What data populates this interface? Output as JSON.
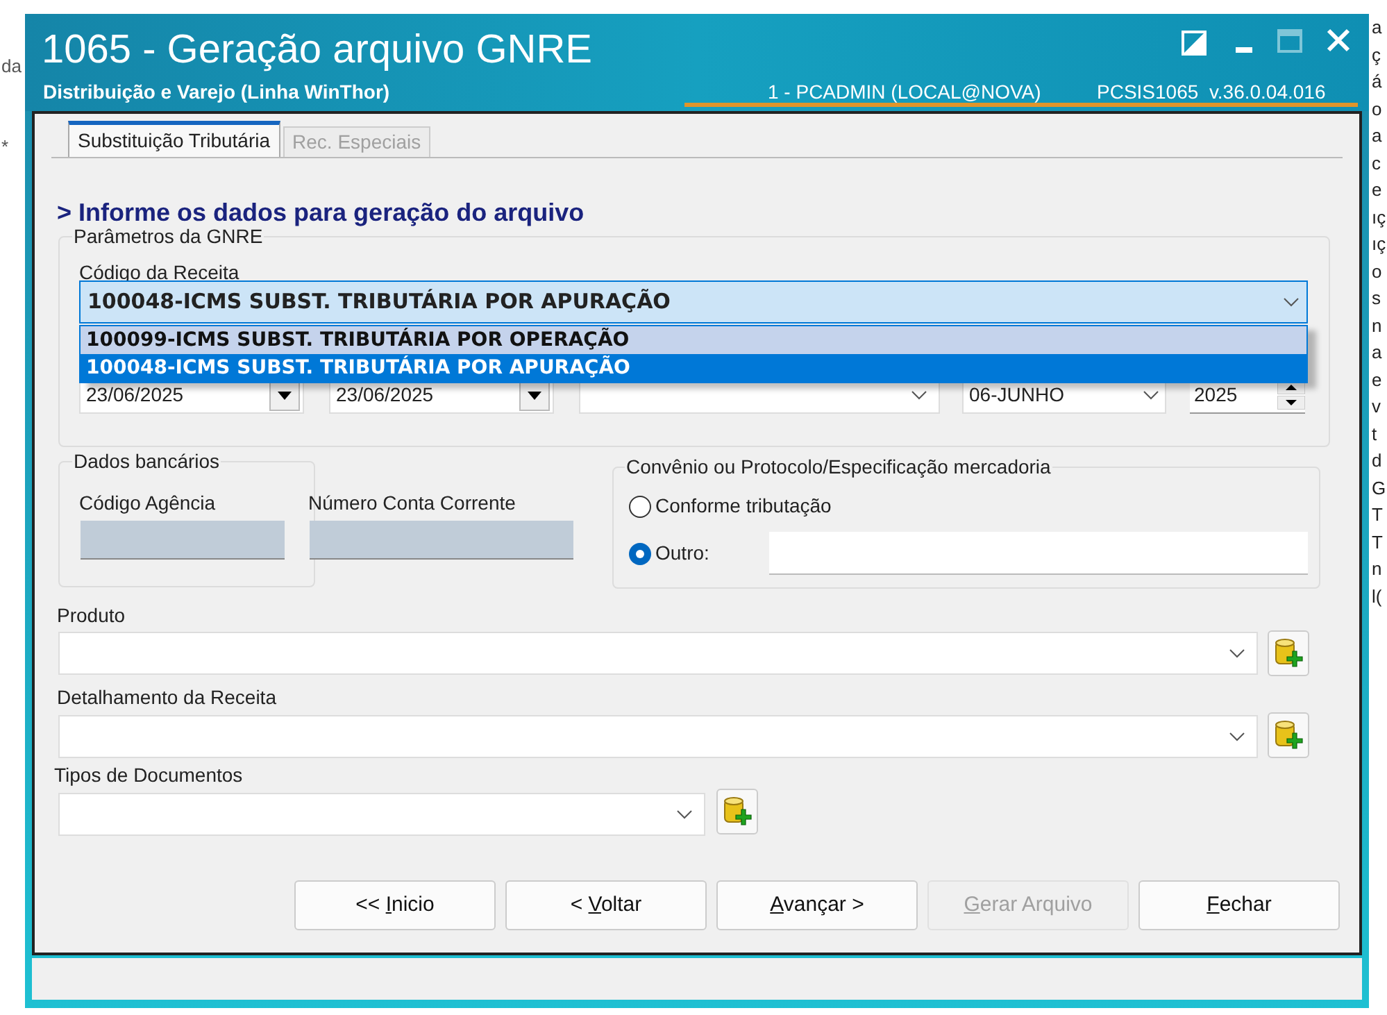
{
  "background": {
    "left_fragments": [
      "da",
      "*"
    ],
    "right_fragments": [
      "a",
      "ç",
      "á",
      "o",
      "a",
      "c",
      "e",
      "ıç",
      "ıç",
      "o",
      "s",
      "n",
      "a",
      "e",
      "v",
      "t",
      "d",
      "G",
      "T",
      "T",
      "n",
      "l("
    ]
  },
  "window": {
    "title": "1065 - Geração arquivo GNRE",
    "subtitle": "Distribuição e Varejo (Linha WinThor)",
    "user": "1 - PCADMIN (LOCAL@NOVA)",
    "version": "PCSIS1065  v.36.0.04.016"
  },
  "tabs": [
    {
      "label": "Substituição Tributária",
      "selected": true,
      "disabled": false
    },
    {
      "label": "Rec. Especiais",
      "selected": false,
      "disabled": true
    }
  ],
  "heading": "> Informe os dados para geração do arquivo",
  "parametros": {
    "title": "Parâmetros da GNRE",
    "codigo_label": "Código da Receita",
    "codigo_value": "100048-ICMS SUBST. TRIBUTÁRIA POR APURAÇÃO",
    "dropdown_items": [
      {
        "label": "100099-ICMS SUBST. TRIBUTÁRIA POR OPERAÇÃO",
        "selected": false
      },
      {
        "label": "100048-ICMS SUBST. TRIBUTÁRIA POR APURAÇÃO",
        "selected": true
      }
    ],
    "date_from": "23/06/2025",
    "date_to": "23/06/2025",
    "month": "06-JUNHO",
    "year": "2025"
  },
  "dados_bancarios": {
    "title": "Dados bancários",
    "agencia_label": "Código Agência",
    "conta_label": "Número Conta Corrente"
  },
  "convenio": {
    "title": "Convênio ou Protocolo/Especificação mercadoria",
    "options": [
      {
        "label": "Conforme tributação",
        "selected": false
      },
      {
        "label": "Outro:",
        "selected": true
      }
    ]
  },
  "produto": {
    "label": "Produto"
  },
  "detalhamento": {
    "label": "Detalhamento da Receita"
  },
  "tipos": {
    "label": "Tipos de Documentos"
  },
  "buttons": [
    {
      "before": "<< ",
      "key": "I",
      "after": "nicio",
      "disabled": false
    },
    {
      "before": "< ",
      "key": "V",
      "after": "oltar",
      "disabled": false
    },
    {
      "key": "A",
      "after": "vançar >",
      "disabled": false
    },
    {
      "key": "G",
      "after": "erar Arquivo",
      "disabled": true
    },
    {
      "key": "F",
      "after": "echar",
      "disabled": false
    }
  ]
}
